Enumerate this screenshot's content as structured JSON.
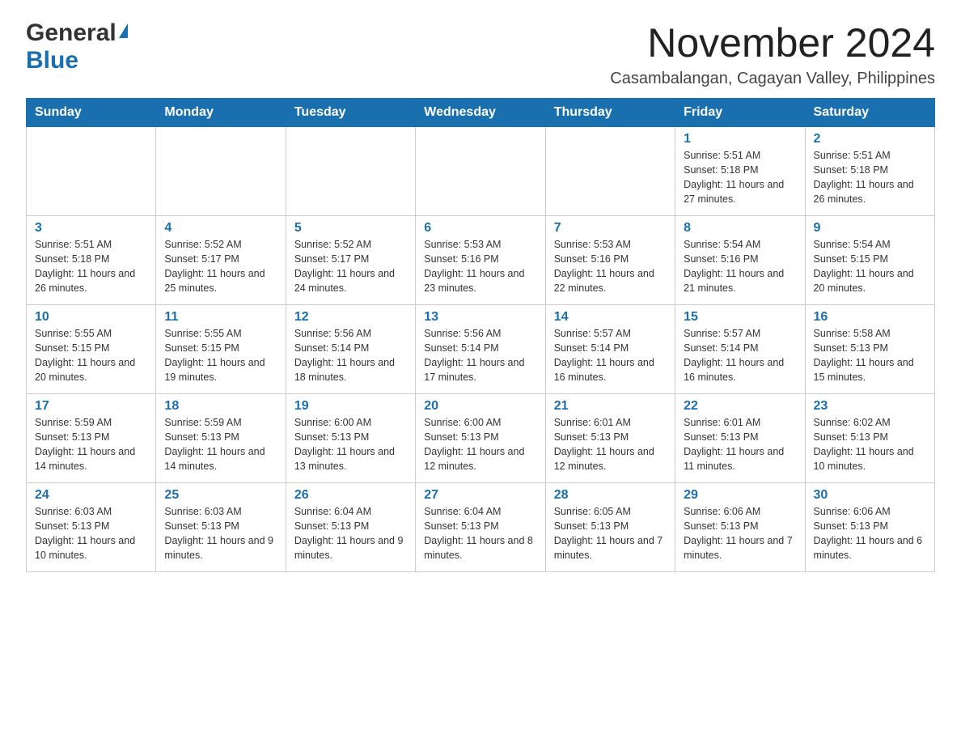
{
  "logo": {
    "general": "General",
    "blue": "Blue"
  },
  "header": {
    "month_year": "November 2024",
    "location": "Casambalangan, Cagayan Valley, Philippines"
  },
  "days_of_week": [
    "Sunday",
    "Monday",
    "Tuesday",
    "Wednesday",
    "Thursday",
    "Friday",
    "Saturday"
  ],
  "weeks": [
    [
      {
        "day": "",
        "info": ""
      },
      {
        "day": "",
        "info": ""
      },
      {
        "day": "",
        "info": ""
      },
      {
        "day": "",
        "info": ""
      },
      {
        "day": "",
        "info": ""
      },
      {
        "day": "1",
        "info": "Sunrise: 5:51 AM\nSunset: 5:18 PM\nDaylight: 11 hours and 27 minutes."
      },
      {
        "day": "2",
        "info": "Sunrise: 5:51 AM\nSunset: 5:18 PM\nDaylight: 11 hours and 26 minutes."
      }
    ],
    [
      {
        "day": "3",
        "info": "Sunrise: 5:51 AM\nSunset: 5:18 PM\nDaylight: 11 hours and 26 minutes."
      },
      {
        "day": "4",
        "info": "Sunrise: 5:52 AM\nSunset: 5:17 PM\nDaylight: 11 hours and 25 minutes."
      },
      {
        "day": "5",
        "info": "Sunrise: 5:52 AM\nSunset: 5:17 PM\nDaylight: 11 hours and 24 minutes."
      },
      {
        "day": "6",
        "info": "Sunrise: 5:53 AM\nSunset: 5:16 PM\nDaylight: 11 hours and 23 minutes."
      },
      {
        "day": "7",
        "info": "Sunrise: 5:53 AM\nSunset: 5:16 PM\nDaylight: 11 hours and 22 minutes."
      },
      {
        "day": "8",
        "info": "Sunrise: 5:54 AM\nSunset: 5:16 PM\nDaylight: 11 hours and 21 minutes."
      },
      {
        "day": "9",
        "info": "Sunrise: 5:54 AM\nSunset: 5:15 PM\nDaylight: 11 hours and 20 minutes."
      }
    ],
    [
      {
        "day": "10",
        "info": "Sunrise: 5:55 AM\nSunset: 5:15 PM\nDaylight: 11 hours and 20 minutes."
      },
      {
        "day": "11",
        "info": "Sunrise: 5:55 AM\nSunset: 5:15 PM\nDaylight: 11 hours and 19 minutes."
      },
      {
        "day": "12",
        "info": "Sunrise: 5:56 AM\nSunset: 5:14 PM\nDaylight: 11 hours and 18 minutes."
      },
      {
        "day": "13",
        "info": "Sunrise: 5:56 AM\nSunset: 5:14 PM\nDaylight: 11 hours and 17 minutes."
      },
      {
        "day": "14",
        "info": "Sunrise: 5:57 AM\nSunset: 5:14 PM\nDaylight: 11 hours and 16 minutes."
      },
      {
        "day": "15",
        "info": "Sunrise: 5:57 AM\nSunset: 5:14 PM\nDaylight: 11 hours and 16 minutes."
      },
      {
        "day": "16",
        "info": "Sunrise: 5:58 AM\nSunset: 5:13 PM\nDaylight: 11 hours and 15 minutes."
      }
    ],
    [
      {
        "day": "17",
        "info": "Sunrise: 5:59 AM\nSunset: 5:13 PM\nDaylight: 11 hours and 14 minutes."
      },
      {
        "day": "18",
        "info": "Sunrise: 5:59 AM\nSunset: 5:13 PM\nDaylight: 11 hours and 14 minutes."
      },
      {
        "day": "19",
        "info": "Sunrise: 6:00 AM\nSunset: 5:13 PM\nDaylight: 11 hours and 13 minutes."
      },
      {
        "day": "20",
        "info": "Sunrise: 6:00 AM\nSunset: 5:13 PM\nDaylight: 11 hours and 12 minutes."
      },
      {
        "day": "21",
        "info": "Sunrise: 6:01 AM\nSunset: 5:13 PM\nDaylight: 11 hours and 12 minutes."
      },
      {
        "day": "22",
        "info": "Sunrise: 6:01 AM\nSunset: 5:13 PM\nDaylight: 11 hours and 11 minutes."
      },
      {
        "day": "23",
        "info": "Sunrise: 6:02 AM\nSunset: 5:13 PM\nDaylight: 11 hours and 10 minutes."
      }
    ],
    [
      {
        "day": "24",
        "info": "Sunrise: 6:03 AM\nSunset: 5:13 PM\nDaylight: 11 hours and 10 minutes."
      },
      {
        "day": "25",
        "info": "Sunrise: 6:03 AM\nSunset: 5:13 PM\nDaylight: 11 hours and 9 minutes."
      },
      {
        "day": "26",
        "info": "Sunrise: 6:04 AM\nSunset: 5:13 PM\nDaylight: 11 hours and 9 minutes."
      },
      {
        "day": "27",
        "info": "Sunrise: 6:04 AM\nSunset: 5:13 PM\nDaylight: 11 hours and 8 minutes."
      },
      {
        "day": "28",
        "info": "Sunrise: 6:05 AM\nSunset: 5:13 PM\nDaylight: 11 hours and 7 minutes."
      },
      {
        "day": "29",
        "info": "Sunrise: 6:06 AM\nSunset: 5:13 PM\nDaylight: 11 hours and 7 minutes."
      },
      {
        "day": "30",
        "info": "Sunrise: 6:06 AM\nSunset: 5:13 PM\nDaylight: 11 hours and 6 minutes."
      }
    ]
  ]
}
